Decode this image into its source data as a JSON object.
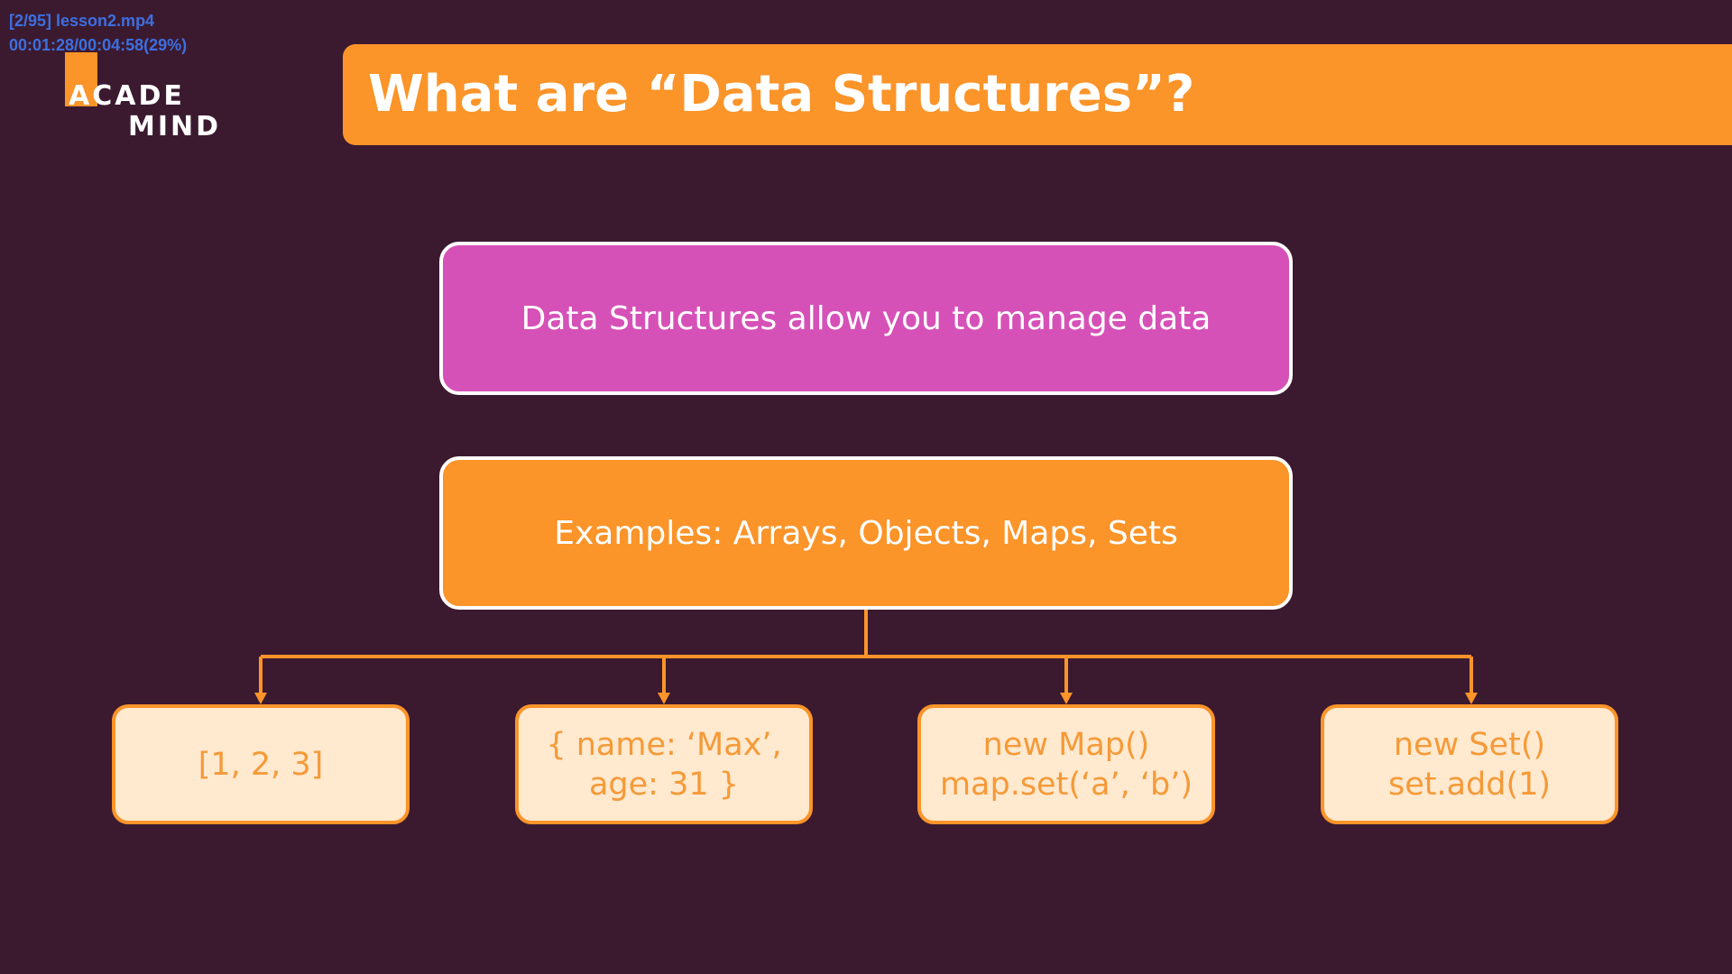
{
  "overlay": {
    "file_label": "[2/95] lesson2.mp4",
    "time_label": "00:01:28/00:04:58(29%)"
  },
  "logo": {
    "line1": "ACADE",
    "line2": "MIND"
  },
  "slide": {
    "title": "What are “Data Structures”?",
    "definition": "Data Structures allow you to manage data",
    "examples_heading": "Examples: Arrays, Objects, Maps, Sets",
    "examples": [
      {
        "line1": "[1, 2, 3]"
      },
      {
        "line1": "{ name: ‘Max’,",
        "line2": "age: 31 }"
      },
      {
        "line1": "new Map()",
        "line2": "map.set(‘a’, ‘b’)"
      },
      {
        "line1": "new Set()",
        "line2": "set.add(1)"
      }
    ]
  },
  "colors": {
    "background": "#3b1a30",
    "accent_orange": "#fb9429",
    "accent_pink": "#d651b7",
    "example_fill": "#ffe9cf",
    "overlay_text": "#3d6fe0"
  }
}
